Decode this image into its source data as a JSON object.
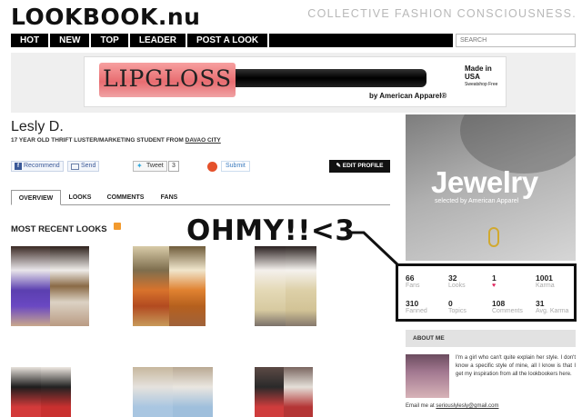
{
  "header": {
    "logo": "LOOKBOOK.nu",
    "tagline": "COLLECTIVE FASHION CONSCIOUSNESS."
  },
  "nav": [
    {
      "label": "HOT"
    },
    {
      "label": "NEW"
    },
    {
      "label": "TOP"
    },
    {
      "label": "LEADER"
    },
    {
      "label": "POST A LOOK"
    }
  ],
  "search": {
    "placeholder": "SEARCH"
  },
  "ad": {
    "product_text": "LIPGLOSS",
    "brand": "by American Apparel®",
    "made_in": "Made in USA",
    "made_in_small": "Sweatshop Free"
  },
  "profile": {
    "name": "Lesly D.",
    "description": "17 YEAR OLD THRIFT LUSTER/MARKETING STUDENT FROM",
    "location": "DAVAO CITY"
  },
  "share": {
    "recommend": "Recommend",
    "send": "Send",
    "tweet": "Tweet",
    "tweet_count": "3",
    "submit": "Submit",
    "edit_profile": "EDIT PROFILE"
  },
  "tabs": [
    {
      "label": "OVERVIEW",
      "active": true
    },
    {
      "label": "LOOKS",
      "active": false
    },
    {
      "label": "COMMENTS",
      "active": false
    },
    {
      "label": "FANS",
      "active": false
    }
  ],
  "section_title": "MOST RECENT LOOKS",
  "annotation": "OHMY!!<3",
  "sidebar_ad": {
    "title": "Jewelry",
    "subtitle": "selected by American Apparel"
  },
  "stats": [
    {
      "value": "66",
      "label": "Fans"
    },
    {
      "value": "32",
      "label": "Looks"
    },
    {
      "value": "1",
      "label": "♥"
    },
    {
      "value": "1001",
      "label": "Karma"
    },
    {
      "value": "310",
      "label": "Fanned"
    },
    {
      "value": "0",
      "label": "Topics"
    },
    {
      "value": "108",
      "label": "Comments"
    },
    {
      "value": "31",
      "label": "Avg. Karma"
    }
  ],
  "about": {
    "heading": "ABOUT ME",
    "text": "I'm a girl who can't quite explain her style. I don't know a specific style of mine, all I know is that I get my inspiration from all the lookbookers here.",
    "email_label": "Email me at",
    "email": "seriouslylesly@gmail.com"
  },
  "colors": {
    "nav_bg": "#000000",
    "accent_heart": "#e0245e",
    "link_blue": "#3b5998"
  }
}
